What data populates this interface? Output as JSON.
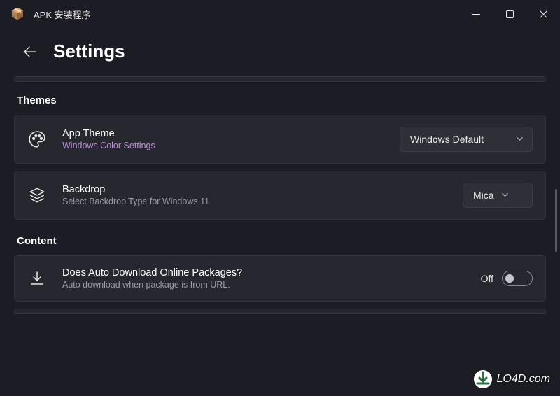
{
  "window": {
    "title": "APK 安装程序"
  },
  "page": {
    "title": "Settings"
  },
  "sections": {
    "themes": {
      "header": "Themes",
      "app_theme": {
        "title": "App Theme",
        "subtitle": "Windows Color Settings",
        "selected": "Windows Default"
      },
      "backdrop": {
        "title": "Backdrop",
        "subtitle": "Select Backdrop Type for Windows 11",
        "selected": "Mica"
      }
    },
    "content": {
      "header": "Content",
      "auto_download": {
        "title": "Does Auto Download Online Packages?",
        "subtitle": "Auto download when package is from URL.",
        "state_label": "Off"
      }
    }
  },
  "watermark": "LO4D.com"
}
